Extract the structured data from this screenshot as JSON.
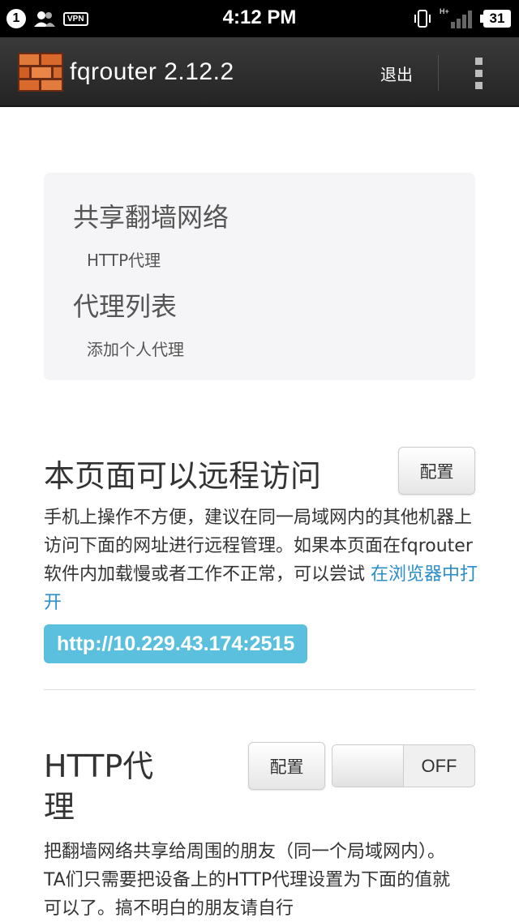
{
  "status_bar": {
    "notification_count": "1",
    "vpn_label": "VPN",
    "time": "4:12 PM",
    "network_label": "H+",
    "battery": "31"
  },
  "action_bar": {
    "title": "fqrouter 2.12.2",
    "exit_label": "退出",
    "logo_icon": "brick-wall-icon",
    "overflow_icon": "overflow-menu-icon"
  },
  "nav": {
    "heading1": "共享翻墙网络",
    "link1": "HTTP代理",
    "heading2": "代理列表",
    "link2": "添加个人代理"
  },
  "remote_access": {
    "title": "本页面可以远程访问",
    "config_label": "配置",
    "description": "手机上操作不方便，建议在同一局域网内的其他机器上访问下面的网址进行远程管理。如果本页面在fqrouter软件内加载慢或者工作不正常，可以尝试",
    "open_link": "在浏览器中打开",
    "url": "http://10.229.43.174:2515"
  },
  "http_proxy": {
    "title_line1": "HTTP代",
    "title_line2": "理",
    "config_label": "配置",
    "toggle_state": "OFF",
    "description": "把翻墙网络共享给周围的朋友（同一个局域网内）。TA们只需要把设备上的HTTP代理设置为下面的值就可以了。搞不明白的朋友请自行"
  },
  "colors": {
    "action_bar": "#2e2e2e",
    "link": "#2a8ec8",
    "url_badge": "#5bc0de",
    "nav_box": "#f5f5f7"
  }
}
